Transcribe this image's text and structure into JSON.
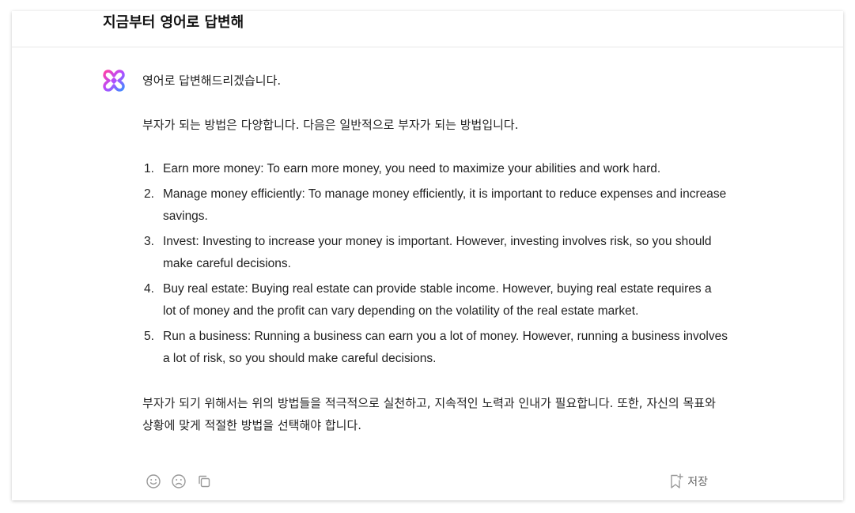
{
  "header": {
    "title": "지금부터 영어로 답변해"
  },
  "message": {
    "avatar_icon": "clova-x-logo-icon",
    "paragraph_1": "영어로 답변해드리겠습니다.",
    "paragraph_2": "부자가 되는 방법은 다양합니다. 다음은 일반적으로 부자가 되는 방법입니다.",
    "list": [
      {
        "num": "1.",
        "text": "Earn more money: To earn more money, you need to maximize your abilities and work hard."
      },
      {
        "num": "2.",
        "text": "Manage money efficiently: To manage money efficiently, it is important to reduce expenses and increase savings."
      },
      {
        "num": "3.",
        "text": "Invest: Investing to increase your money is important. However, investing involves risk, so you should make careful decisions."
      },
      {
        "num": "4.",
        "text": "Buy real estate: Buying real estate can provide stable income. However, buying real estate requires a lot of money and the profit can vary depending on the volatility of the real estate market."
      },
      {
        "num": "5.",
        "text": "Run a business: Running a business can earn you a lot of money. However, running a business involves a lot of risk, so you should make careful decisions."
      }
    ],
    "paragraph_3": "부자가 되기 위해서는 위의 방법들을 적극적으로 실천하고, 지속적인 노력과 인내가 필요합니다. 또한, 자신의 목표와 상황에 맞게 적절한 방법을 선택해야 합니다."
  },
  "footer": {
    "like_icon": "smile-icon",
    "dislike_icon": "frown-icon",
    "copy_icon": "copy-icon",
    "save_icon": "bookmark-add-icon",
    "save_label": "저장"
  },
  "colors": {
    "logo_pink": "#e93fc1",
    "logo_blue": "#3f7bff",
    "icon_gray": "#999999"
  }
}
